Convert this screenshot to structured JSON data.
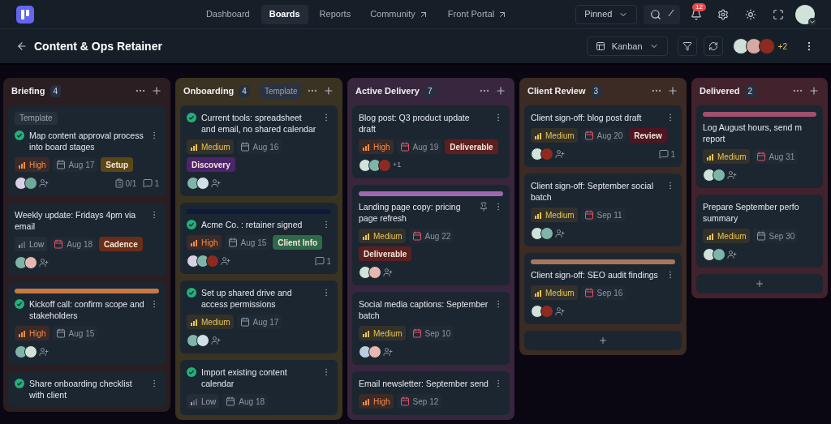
{
  "nav": {
    "items": [
      {
        "label": "Dashboard",
        "selected": false,
        "external": false
      },
      {
        "label": "Boards",
        "selected": true,
        "external": false
      },
      {
        "label": "Reports",
        "selected": false,
        "external": false
      },
      {
        "label": "Community",
        "selected": false,
        "external": true
      },
      {
        "label": "Front Portal",
        "selected": false,
        "external": true
      }
    ],
    "pinned": "Pinned",
    "search_shortcut": "/",
    "notifications": "12"
  },
  "header": {
    "title": "Content & Ops Retainer",
    "view": "Kanban",
    "members": [
      {
        "color": "#cfe0d8"
      },
      {
        "color": "#d7a9a4"
      },
      {
        "color": "#8e2a1f"
      }
    ],
    "more_members": "+2"
  },
  "columns": [
    {
      "name": "Briefing",
      "count": "4",
      "color": "#2a1e22",
      "cards": [
        {
          "template": "Template",
          "done": true,
          "title": "Map content approval process into board stages",
          "priority": {
            "kind": "high",
            "label": "High"
          },
          "date": "Aug 17",
          "due_soon": false,
          "tag": {
            "label": "Setup",
            "color": "#5b4716"
          },
          "avatars": [
            {
              "color": "#d9d0e6"
            },
            {
              "color": "#6fa99a"
            }
          ],
          "add_assignee": true,
          "checklist": "0/1",
          "comments": "1"
        },
        {
          "done": false,
          "title": "Weekly update: Fridays 4pm via email",
          "priority": {
            "kind": "low",
            "label": "Low"
          },
          "date": "Aug 18",
          "due_soon": true,
          "tag": {
            "label": "Cadence",
            "color": "#6a2d17"
          },
          "avatars": [
            {
              "color": "#7fb5a8"
            },
            {
              "color": "#e6b8b0"
            }
          ],
          "add_assignee": true
        },
        {
          "strip": {
            "color": "#c77a45"
          },
          "done": true,
          "title": "Kickoff call: confirm scope and stakeholders",
          "priority": {
            "kind": "high",
            "label": "High"
          },
          "date": "Aug 15",
          "due_soon": false,
          "avatars": [
            {
              "color": "#7fb5a8"
            },
            {
              "color": "#cfe3d9"
            }
          ],
          "add_assignee": true
        },
        {
          "done": true,
          "title": "Share onboarding checklist with client"
        }
      ]
    },
    {
      "name": "Onboarding",
      "count": "4",
      "template": "Template",
      "color": "#3a3322",
      "cards": [
        {
          "done": true,
          "title": "Current tools: spreadsheet and email, no shared calendar",
          "priority": {
            "kind": "medium",
            "label": "Medium"
          },
          "date": "Aug 16",
          "due_soon": false,
          "tag": {
            "label": "Discovery",
            "color": "#4c2468"
          },
          "avatars": [
            {
              "color": "#7fb5a8"
            },
            {
              "color": "#cfe0e8"
            }
          ],
          "add_assignee": true
        },
        {
          "strip": {
            "color": "#0f1a3a"
          },
          "done": true,
          "title": "Acme Co. : retainer signed",
          "priority": {
            "kind": "high",
            "label": "High"
          },
          "date": "Aug 15",
          "due_soon": false,
          "tag": {
            "label": "Client Info",
            "color": "#2e6a4a"
          },
          "avatars": [
            {
              "color": "#d9d0e6"
            },
            {
              "color": "#7fb5a8"
            },
            {
              "color": "#8e2a1f"
            }
          ],
          "add_assignee": true,
          "comments": "1"
        },
        {
          "done": true,
          "title": "Set up shared drive and access permissions",
          "priority": {
            "kind": "medium",
            "label": "Medium"
          },
          "date": "Aug 17",
          "due_soon": false,
          "avatars": [
            {
              "color": "#7fb5a8"
            },
            {
              "color": "#cfe0e8"
            }
          ],
          "add_assignee": true
        },
        {
          "done": true,
          "title": "Import existing content calendar",
          "priority": {
            "kind": "low",
            "label": "Low"
          },
          "date": "Aug 18",
          "due_soon": false
        }
      ]
    },
    {
      "name": "Active Delivery",
      "count": "7",
      "color": "#37263d",
      "cards": [
        {
          "done": false,
          "title": "Blog post: Q3 product update draft",
          "priority": {
            "kind": "high",
            "label": "High"
          },
          "date": "Aug 19",
          "due_soon": true,
          "tag": {
            "label": "Deliverable",
            "color": "#5c1f1f"
          },
          "avatars": [
            {
              "color": "#cfe3d9"
            },
            {
              "color": "#7fb5a8"
            },
            {
              "color": "#8e2a1f"
            }
          ],
          "add_assignee": false,
          "extra": "+1"
        },
        {
          "strip": {
            "color": "#a066b0"
          },
          "pinned": true,
          "done": false,
          "title": "Landing page copy: pricing page refresh",
          "priority": {
            "kind": "medium",
            "label": "Medium"
          },
          "date": "Aug 22",
          "due_soon": true,
          "tag": {
            "label": "Deliverable",
            "color": "#5c1f1f"
          },
          "avatars": [
            {
              "color": "#cfe3d9"
            },
            {
              "color": "#e6b8b0"
            }
          ],
          "add_assignee": true
        },
        {
          "done": false,
          "title": "Social media captions: September batch",
          "priority": {
            "kind": "medium",
            "label": "Medium"
          },
          "date": "Sep 10",
          "due_soon": true,
          "avatars": [
            {
              "color": "#b8cfe0"
            },
            {
              "color": "#e6b8b0"
            }
          ],
          "add_assignee": true
        },
        {
          "done": false,
          "title": "Email newsletter: September send",
          "priority": {
            "kind": "high",
            "label": "High"
          },
          "date": "Sep 12",
          "due_soon": true
        }
      ]
    },
    {
      "name": "Client Review",
      "count": "3",
      "color": "#3b2b24",
      "add_card": true,
      "cards": [
        {
          "done": false,
          "title": "Client sign-off: blog post draft",
          "priority": {
            "kind": "medium",
            "label": "Medium"
          },
          "date": "Aug 20",
          "due_soon": true,
          "tag": {
            "label": "Review",
            "color": "#4d1620"
          },
          "avatars": [
            {
              "color": "#cfe3d9"
            },
            {
              "color": "#8e2a1f"
            }
          ],
          "add_assignee": true,
          "comments": "1"
        },
        {
          "done": false,
          "title": "Client sign-off: September social batch",
          "priority": {
            "kind": "medium",
            "label": "Medium"
          },
          "date": "Sep 11",
          "due_soon": true,
          "avatars": [
            {
              "color": "#cfe3d9"
            },
            {
              "color": "#7fb5a8"
            }
          ],
          "add_assignee": true
        },
        {
          "strip": {
            "color": "#a8765a"
          },
          "done": false,
          "title": "Client sign-off: SEO audit findings",
          "priority": {
            "kind": "medium",
            "label": "Medium"
          },
          "date": "Sep 16",
          "due_soon": true,
          "avatars": [
            {
              "color": "#cfe3d9"
            },
            {
              "color": "#8e2a1f"
            }
          ],
          "add_assignee": true
        }
      ]
    },
    {
      "name": "Delivered",
      "count": "2",
      "color": "#42222d",
      "add_card": true,
      "cards": [
        {
          "strip": {
            "color": "#a0506e"
          },
          "done": false,
          "title": "Log August hours, send m\nreport",
          "priority": {
            "kind": "medium",
            "label": "Medium"
          },
          "date": "Aug 31",
          "due_soon": true,
          "avatars": [
            {
              "color": "#cfe3d9"
            },
            {
              "color": "#7fb5a8"
            }
          ],
          "add_assignee": true
        },
        {
          "done": false,
          "title": "Prepare September perfo\nsummary",
          "priority": {
            "kind": "medium",
            "label": "Medium"
          },
          "date": "Sep 30",
          "due_soon": false,
          "avatars": [
            {
              "color": "#cfe3d9"
            },
            {
              "color": "#7fb5a8"
            }
          ],
          "add_assignee": true
        }
      ]
    }
  ]
}
